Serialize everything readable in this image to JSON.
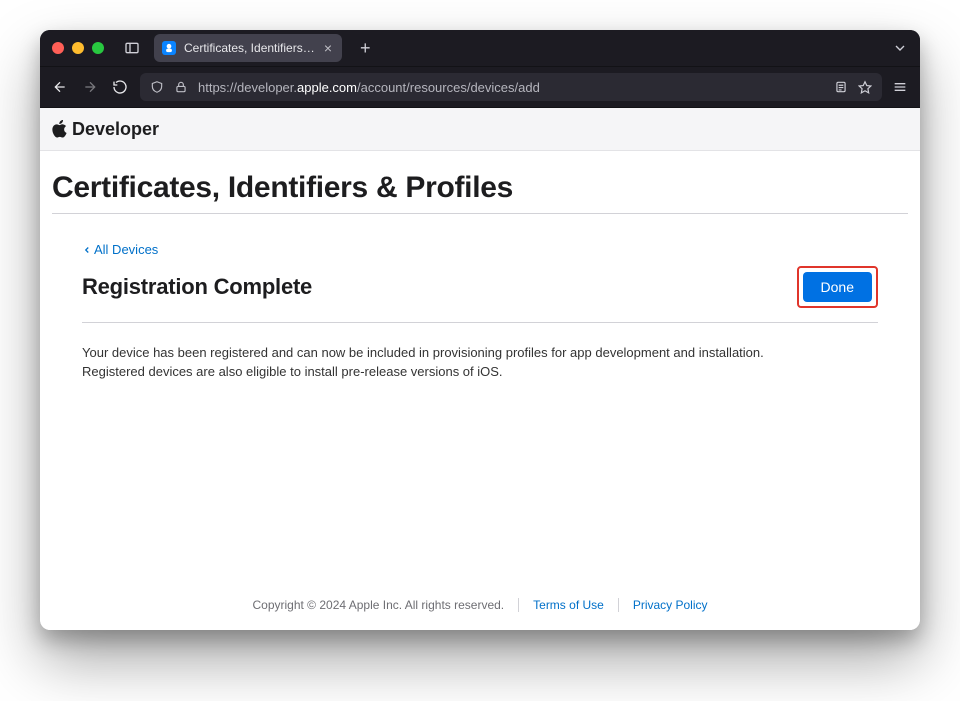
{
  "browser": {
    "tab_title": "Certificates, Identifiers & Profiles",
    "new_tab_label": "+",
    "url_prefix": "https://developer.",
    "url_host": "apple.com",
    "url_path": "/account/resources/devices/add"
  },
  "header": {
    "developer_label": "Developer"
  },
  "page": {
    "section_title": "Certificates, Identifiers & Profiles",
    "back_link_label": "All Devices",
    "subtitle": "Registration Complete",
    "done_label": "Done",
    "body_text": "Your device has been registered and can now be included in provisioning profiles for app development and installation.\nRegistered devices are also eligible to install pre-release versions of iOS."
  },
  "footer": {
    "copyright": "Copyright © 2024 Apple Inc. All rights reserved.",
    "terms_label": "Terms of Use",
    "privacy_label": "Privacy Policy"
  }
}
